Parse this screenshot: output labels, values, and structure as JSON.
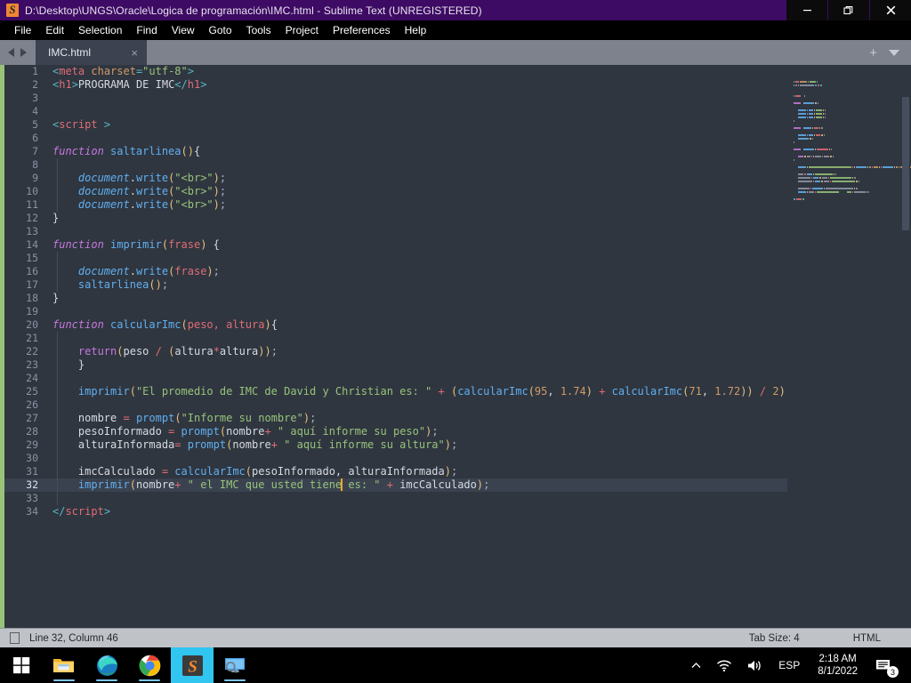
{
  "window": {
    "title": "D:\\Desktop\\UNGS\\Oracle\\Logica de programación\\IMC.html - Sublime Text (UNREGISTERED)",
    "logo_icon": "sublime-text-logo-icon",
    "minimize_label": "minimize-icon",
    "maximize_label": "restore-icon",
    "close_label": "close-icon"
  },
  "menubar": {
    "items": [
      {
        "label": "File"
      },
      {
        "label": "Edit"
      },
      {
        "label": "Selection"
      },
      {
        "label": "Find"
      },
      {
        "label": "View"
      },
      {
        "label": "Goto"
      },
      {
        "label": "Tools"
      },
      {
        "label": "Project"
      },
      {
        "label": "Preferences"
      },
      {
        "label": "Help"
      }
    ]
  },
  "tabbar": {
    "prev_icon": "arrow-left-icon",
    "next_icon": "arrow-right-icon",
    "tabs": [
      {
        "label": "IMC.html",
        "close": "×",
        "active": true
      }
    ],
    "new_tab_label": "+",
    "tab_menu_icon": "chevron-down-icon"
  },
  "editor": {
    "cursor_line": 32,
    "cursor_column": 46,
    "lines": [
      {
        "n": 1,
        "tokens": [
          {
            "t": "<",
            "c": "t-punc"
          },
          {
            "t": "meta",
            "c": "t-tag"
          },
          {
            "t": " charset",
            "c": "t-attr"
          },
          {
            "t": "=",
            "c": "t-punc"
          },
          {
            "t": "\"utf-8\"",
            "c": "t-str"
          },
          {
            "t": ">",
            "c": "t-punc"
          }
        ]
      },
      {
        "n": 2,
        "tokens": [
          {
            "t": "<",
            "c": "t-punc"
          },
          {
            "t": "h1",
            "c": "t-tag"
          },
          {
            "t": ">",
            "c": "t-punc"
          },
          {
            "t": "PROGRAMA DE IMC",
            "c": "t-plain"
          },
          {
            "t": "</",
            "c": "t-punc"
          },
          {
            "t": "h1",
            "c": "t-tag"
          },
          {
            "t": ">",
            "c": "t-punc"
          }
        ]
      },
      {
        "n": 3,
        "tokens": []
      },
      {
        "n": 4,
        "tokens": []
      },
      {
        "n": 5,
        "tokens": [
          {
            "t": "<",
            "c": "t-punc"
          },
          {
            "t": "script",
            "c": "t-tag"
          },
          {
            "t": " ",
            "c": "t-plain"
          },
          {
            "t": ">",
            "c": "t-punc"
          }
        ]
      },
      {
        "n": 6,
        "tokens": []
      },
      {
        "n": 7,
        "tokens": [
          {
            "t": "function",
            "c": "t-kw"
          },
          {
            "t": " ",
            "c": "t-plain"
          },
          {
            "t": "saltarlinea",
            "c": "t-fn"
          },
          {
            "t": "()",
            "c": "t-paren"
          },
          {
            "t": "{",
            "c": "t-plain"
          }
        ]
      },
      {
        "n": 8,
        "tokens": []
      },
      {
        "n": 9,
        "tokens": [
          {
            "t": "    ",
            "c": "t-plain"
          },
          {
            "t": "document",
            "c": "t-obj"
          },
          {
            "t": ".",
            "c": "t-plain"
          },
          {
            "t": "write",
            "c": "t-prop"
          },
          {
            "t": "(",
            "c": "t-paren"
          },
          {
            "t": "\"<br>\"",
            "c": "t-str"
          },
          {
            "t": ")",
            "c": "t-paren"
          },
          {
            "t": ";",
            "c": "t-semi"
          }
        ]
      },
      {
        "n": 10,
        "tokens": [
          {
            "t": "    ",
            "c": "t-plain"
          },
          {
            "t": "document",
            "c": "t-obj"
          },
          {
            "t": ".",
            "c": "t-plain"
          },
          {
            "t": "write",
            "c": "t-prop"
          },
          {
            "t": "(",
            "c": "t-paren"
          },
          {
            "t": "\"<br>\"",
            "c": "t-str"
          },
          {
            "t": ")",
            "c": "t-paren"
          },
          {
            "t": ";",
            "c": "t-semi"
          }
        ]
      },
      {
        "n": 11,
        "tokens": [
          {
            "t": "    ",
            "c": "t-plain"
          },
          {
            "t": "document",
            "c": "t-obj"
          },
          {
            "t": ".",
            "c": "t-plain"
          },
          {
            "t": "write",
            "c": "t-prop"
          },
          {
            "t": "(",
            "c": "t-paren"
          },
          {
            "t": "\"<br>\"",
            "c": "t-str"
          },
          {
            "t": ")",
            "c": "t-paren"
          },
          {
            "t": ";",
            "c": "t-semi"
          }
        ]
      },
      {
        "n": 12,
        "tokens": [
          {
            "t": "}",
            "c": "t-plain"
          }
        ]
      },
      {
        "n": 13,
        "tokens": []
      },
      {
        "n": 14,
        "tokens": [
          {
            "t": "function",
            "c": "t-kw"
          },
          {
            "t": " ",
            "c": "t-plain"
          },
          {
            "t": "imprimir",
            "c": "t-fn"
          },
          {
            "t": "(",
            "c": "t-paren"
          },
          {
            "t": "frase",
            "c": "t-param"
          },
          {
            "t": ")",
            "c": "t-paren"
          },
          {
            "t": " {",
            "c": "t-plain"
          }
        ]
      },
      {
        "n": 15,
        "tokens": []
      },
      {
        "n": 16,
        "tokens": [
          {
            "t": "    ",
            "c": "t-plain"
          },
          {
            "t": "document",
            "c": "t-obj"
          },
          {
            "t": ".",
            "c": "t-plain"
          },
          {
            "t": "write",
            "c": "t-prop"
          },
          {
            "t": "(",
            "c": "t-paren"
          },
          {
            "t": "frase",
            "c": "t-param"
          },
          {
            "t": ")",
            "c": "t-paren"
          },
          {
            "t": ";",
            "c": "t-semi"
          }
        ]
      },
      {
        "n": 17,
        "tokens": [
          {
            "t": "    ",
            "c": "t-plain"
          },
          {
            "t": "saltarlinea",
            "c": "t-prop"
          },
          {
            "t": "()",
            "c": "t-paren"
          },
          {
            "t": ";",
            "c": "t-semi"
          }
        ]
      },
      {
        "n": 18,
        "tokens": [
          {
            "t": "}",
            "c": "t-plain"
          }
        ]
      },
      {
        "n": 19,
        "tokens": []
      },
      {
        "n": 20,
        "tokens": [
          {
            "t": "function",
            "c": "t-kw"
          },
          {
            "t": " ",
            "c": "t-plain"
          },
          {
            "t": "calcularImc",
            "c": "t-fn"
          },
          {
            "t": "(",
            "c": "t-paren"
          },
          {
            "t": "peso, altura",
            "c": "t-param"
          },
          {
            "t": ")",
            "c": "t-paren"
          },
          {
            "t": "{",
            "c": "t-plain"
          }
        ]
      },
      {
        "n": 21,
        "tokens": []
      },
      {
        "n": 22,
        "tokens": [
          {
            "t": "    ",
            "c": "t-plain"
          },
          {
            "t": "return",
            "c": "t-ret"
          },
          {
            "t": "(",
            "c": "t-paren"
          },
          {
            "t": "peso",
            "c": "t-plain"
          },
          {
            "t": " / ",
            "c": "t-op"
          },
          {
            "t": "(",
            "c": "t-paren"
          },
          {
            "t": "altura",
            "c": "t-plain"
          },
          {
            "t": "*",
            "c": "t-op"
          },
          {
            "t": "altura",
            "c": "t-plain"
          },
          {
            "t": "))",
            "c": "t-paren"
          },
          {
            "t": ";",
            "c": "t-semi"
          }
        ]
      },
      {
        "n": 23,
        "tokens": [
          {
            "t": "    }",
            "c": "t-plain"
          }
        ]
      },
      {
        "n": 24,
        "tokens": []
      },
      {
        "n": 25,
        "tokens": [
          {
            "t": "    ",
            "c": "t-plain"
          },
          {
            "t": "imprimir",
            "c": "t-prop"
          },
          {
            "t": "(",
            "c": "t-paren"
          },
          {
            "t": "\"El promedio de IMC de David y Christian es: \"",
            "c": "t-str"
          },
          {
            "t": " + ",
            "c": "t-op"
          },
          {
            "t": "(",
            "c": "t-paren"
          },
          {
            "t": "calcularImc",
            "c": "t-prop"
          },
          {
            "t": "(",
            "c": "t-paren"
          },
          {
            "t": "95",
            "c": "t-num"
          },
          {
            "t": ", ",
            "c": "t-plain"
          },
          {
            "t": "1.74",
            "c": "t-num"
          },
          {
            "t": ")",
            "c": "t-paren"
          },
          {
            "t": " + ",
            "c": "t-op"
          },
          {
            "t": "calcularImc",
            "c": "t-prop"
          },
          {
            "t": "(",
            "c": "t-paren"
          },
          {
            "t": "71",
            "c": "t-num"
          },
          {
            "t": ", ",
            "c": "t-plain"
          },
          {
            "t": "1.72",
            "c": "t-num"
          },
          {
            "t": "))",
            "c": "t-paren"
          },
          {
            "t": " / ",
            "c": "t-op"
          },
          {
            "t": "2",
            "c": "t-num"
          },
          {
            "t": ")",
            "c": "t-paren"
          },
          {
            "t": ";",
            "c": "t-semi"
          }
        ]
      },
      {
        "n": 26,
        "tokens": []
      },
      {
        "n": 27,
        "tokens": [
          {
            "t": "    ",
            "c": "t-plain"
          },
          {
            "t": "nombre",
            "c": "t-plain"
          },
          {
            "t": " = ",
            "c": "t-op"
          },
          {
            "t": "prompt",
            "c": "t-prop"
          },
          {
            "t": "(",
            "c": "t-paren"
          },
          {
            "t": "\"Informe su nombre\"",
            "c": "t-str"
          },
          {
            "t": ")",
            "c": "t-paren"
          },
          {
            "t": ";",
            "c": "t-semi"
          }
        ]
      },
      {
        "n": 28,
        "tokens": [
          {
            "t": "    ",
            "c": "t-plain"
          },
          {
            "t": "pesoInformado",
            "c": "t-plain"
          },
          {
            "t": " = ",
            "c": "t-op"
          },
          {
            "t": "prompt",
            "c": "t-prop"
          },
          {
            "t": "(",
            "c": "t-paren"
          },
          {
            "t": "nombre",
            "c": "t-plain"
          },
          {
            "t": "+ ",
            "c": "t-op"
          },
          {
            "t": "\" aquí informe su peso\"",
            "c": "t-str"
          },
          {
            "t": ")",
            "c": "t-paren"
          },
          {
            "t": ";",
            "c": "t-semi"
          }
        ]
      },
      {
        "n": 29,
        "tokens": [
          {
            "t": "    ",
            "c": "t-plain"
          },
          {
            "t": "alturaInformada",
            "c": "t-plain"
          },
          {
            "t": "= ",
            "c": "t-op"
          },
          {
            "t": "prompt",
            "c": "t-prop"
          },
          {
            "t": "(",
            "c": "t-paren"
          },
          {
            "t": "nombre",
            "c": "t-plain"
          },
          {
            "t": "+ ",
            "c": "t-op"
          },
          {
            "t": "\" aquí informe su altura\"",
            "c": "t-str"
          },
          {
            "t": ")",
            "c": "t-paren"
          },
          {
            "t": ";",
            "c": "t-semi"
          }
        ]
      },
      {
        "n": 30,
        "tokens": []
      },
      {
        "n": 31,
        "tokens": [
          {
            "t": "    ",
            "c": "t-plain"
          },
          {
            "t": "imcCalculado",
            "c": "t-plain"
          },
          {
            "t": " = ",
            "c": "t-op"
          },
          {
            "t": "calcularImc",
            "c": "t-prop"
          },
          {
            "t": "(",
            "c": "t-paren"
          },
          {
            "t": "pesoInformado, alturaInformada",
            "c": "t-plain"
          },
          {
            "t": ")",
            "c": "t-paren"
          },
          {
            "t": ";",
            "c": "t-semi"
          }
        ]
      },
      {
        "n": 32,
        "active": true,
        "tokens": [
          {
            "t": "    ",
            "c": "t-plain"
          },
          {
            "t": "imprimir",
            "c": "t-prop"
          },
          {
            "t": "(",
            "c": "t-paren"
          },
          {
            "t": "nombre",
            "c": "t-plain"
          },
          {
            "t": "+ ",
            "c": "t-op"
          },
          {
            "t": "\" el IMC que usted tiene",
            "c": "t-str"
          },
          {
            "t": "CURSOR",
            "c": "cursor"
          },
          {
            "t": " es: \"",
            "c": "t-str"
          },
          {
            "t": " + ",
            "c": "t-op"
          },
          {
            "t": "imcCalculado",
            "c": "t-plain"
          },
          {
            "t": ")",
            "c": "t-paren"
          },
          {
            "t": ";",
            "c": "t-semi"
          }
        ]
      },
      {
        "n": 33,
        "tokens": []
      },
      {
        "n": 34,
        "tokens": [
          {
            "t": "</",
            "c": "t-punc"
          },
          {
            "t": "script",
            "c": "t-tag"
          },
          {
            "t": ">",
            "c": "t-punc"
          }
        ]
      }
    ]
  },
  "statusbar": {
    "encoding_icon": "file-icon",
    "position": "Line 32, Column 46",
    "tab_size": "Tab Size: 4",
    "syntax": "HTML"
  },
  "taskbar": {
    "start_icon": "windows-start-icon",
    "apps": [
      {
        "name": "file-explorer-icon",
        "active": false,
        "running": true
      },
      {
        "name": "microsoft-edge-icon",
        "active": false,
        "running": true
      },
      {
        "name": "google-chrome-icon",
        "active": false,
        "running": true
      },
      {
        "name": "sublime-text-icon",
        "active": true,
        "running": true
      },
      {
        "name": "remote-desktop-icon",
        "active": false,
        "running": true
      }
    ],
    "tray": {
      "overflow_icon": "chevron-up-icon",
      "network_icon": "wifi-icon",
      "volume_icon": "speaker-icon",
      "language": "ESP",
      "time": "2:18 AM",
      "date": "8/1/2022",
      "notifications_icon": "notification-icon",
      "notifications_count": "3"
    }
  },
  "colors": {
    "titlebar": "#3d0b63",
    "editor_bg": "#2f3640",
    "accent_green": "#98c379",
    "cursor": "#f5a623",
    "taskbar_active": "#30c6f0"
  }
}
